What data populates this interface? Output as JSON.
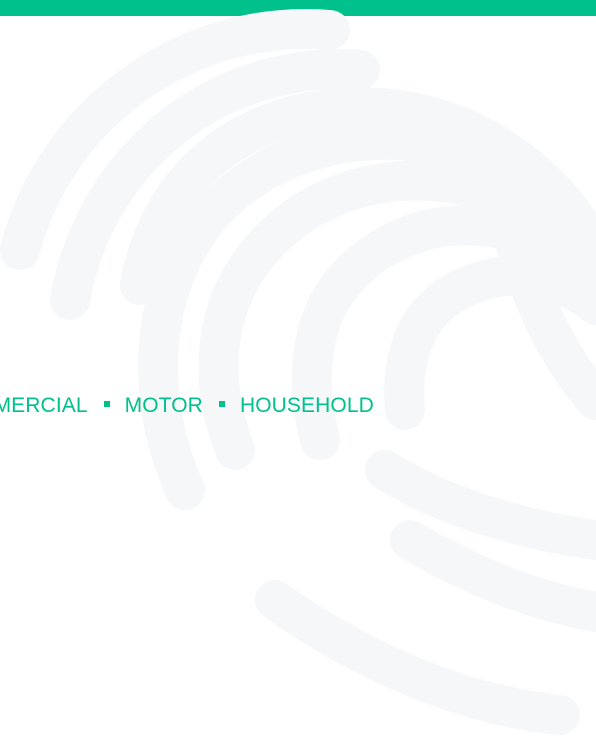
{
  "colors": {
    "brand": "#00c08b",
    "background": "#ffffff",
    "watermark": "#f6f7f8"
  },
  "decoration": {
    "watermark_icon": "fingerprint-icon"
  },
  "tagline": {
    "items": [
      "MMERCIAL",
      "MOTOR",
      "HOUSEHOLD"
    ],
    "separator_icon": "square-bullet-icon"
  }
}
